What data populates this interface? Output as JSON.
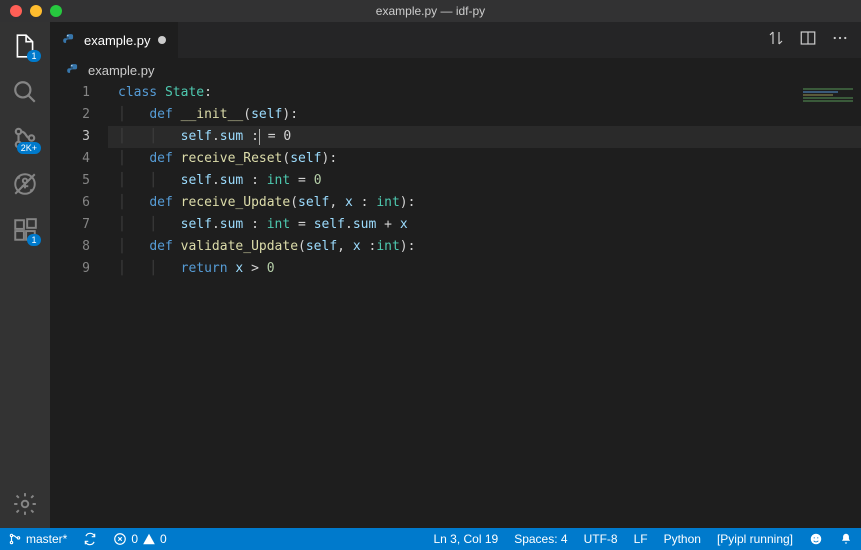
{
  "window": {
    "title": "example.py — idf-py"
  },
  "activity": {
    "explorer_badge": "1",
    "scm_badge": "2K+",
    "ext_badge": "1"
  },
  "tab": {
    "filename": "example.py"
  },
  "breadcrumb": {
    "filename": "example.py"
  },
  "editor": {
    "current_line": 3,
    "lines": [
      "1",
      "2",
      "3",
      "4",
      "5",
      "6",
      "7",
      "8",
      "9"
    ]
  },
  "code": {
    "l1": {
      "kw": "class",
      "cls": "State",
      "tail": ":"
    },
    "l2": {
      "kw": "def",
      "fn": "__init__",
      "p1": "self",
      "tail": "):"
    },
    "l3": {
      "slf": "self",
      "prop": "sum",
      "tail": " = 0"
    },
    "l4": {
      "kw": "def",
      "fn": "receive_Reset",
      "p1": "self",
      "tail": "):"
    },
    "l5": {
      "slf": "self",
      "prop": "sum",
      "typ": "int",
      "val": "0"
    },
    "l6": {
      "kw": "def",
      "fn": "receive_Update",
      "p1": "self",
      "p2": "x",
      "typ": "int",
      "tail": "):"
    },
    "l7": {
      "slf": "self",
      "prop": "sum",
      "typ": "int",
      "slf2": "self",
      "prop2": "sum",
      "p2": "x"
    },
    "l8": {
      "kw": "def",
      "fn": "validate_Update",
      "p1": "self",
      "p2": "x",
      "typ": "int",
      "tail": "):"
    },
    "l9": {
      "kw": "return",
      "p1": "x",
      "op": ">",
      "val": "0"
    }
  },
  "status": {
    "branch": "master*",
    "errors": "0",
    "warnings": "0",
    "position": "Ln 3, Col 19",
    "spaces": "Spaces: 4",
    "encoding": "UTF-8",
    "eol": "LF",
    "language": "Python",
    "task": "[Pyipl running]"
  }
}
